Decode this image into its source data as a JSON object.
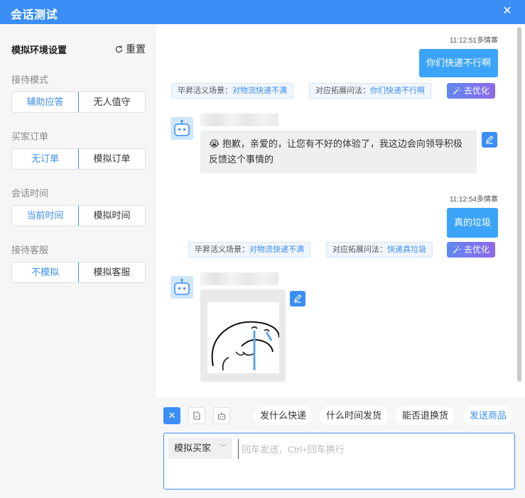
{
  "window": {
    "title": "会话测试"
  },
  "sidebar": {
    "heading": "模拟环境设置",
    "reset_label": "重置",
    "groups": [
      {
        "label": "接待模式",
        "options": [
          "辅助应答",
          "无人值守"
        ],
        "selected": 0
      },
      {
        "label": "买家订单",
        "options": [
          "无订单",
          "模拟订单"
        ],
        "selected": 0
      },
      {
        "label": "会话时间",
        "options": [
          "当前时间",
          "模拟时间"
        ],
        "selected": 0
      },
      {
        "label": "接待客服",
        "options": [
          "不模拟",
          "模拟客服"
        ],
        "selected": 0
      }
    ]
  },
  "chat": {
    "messages": [
      {
        "time": "11:12:51多情寨",
        "text": "你们快递不行啊",
        "scene_label": "毕昇活义场景：",
        "scene_value": "对物流快递不满",
        "ask_label": "对应拓展问法：",
        "ask_value": "你们快递不行啊",
        "optimize_label": "去优化",
        "reply_emoji": "😭",
        "reply_text": "抱歉，亲爱的，让您有不好的体验了，我这边会向领导积极反馈这个事情的"
      },
      {
        "time": "11:12:54多情寨",
        "text": "真的垃圾",
        "scene_label": "毕昇活义场景：",
        "scene_value": "对物流快递不满",
        "ask_label": "对应拓展问法：",
        "ask_value": "快递真垃圾",
        "optimize_label": "去优化"
      }
    ]
  },
  "toolbar": {
    "quick_replies": [
      "发什么快递",
      "什么时间发货",
      "能否退换货"
    ],
    "send_product": "发送商品"
  },
  "composer": {
    "role": "模拟买家",
    "placeholder": "回车发送，Ctrl+回车换行"
  },
  "colors": {
    "accent": "#3a8ef6",
    "bubble": "#3ba4f9",
    "gradient_start": "#5f88f0",
    "gradient_end": "#8e68e8"
  }
}
